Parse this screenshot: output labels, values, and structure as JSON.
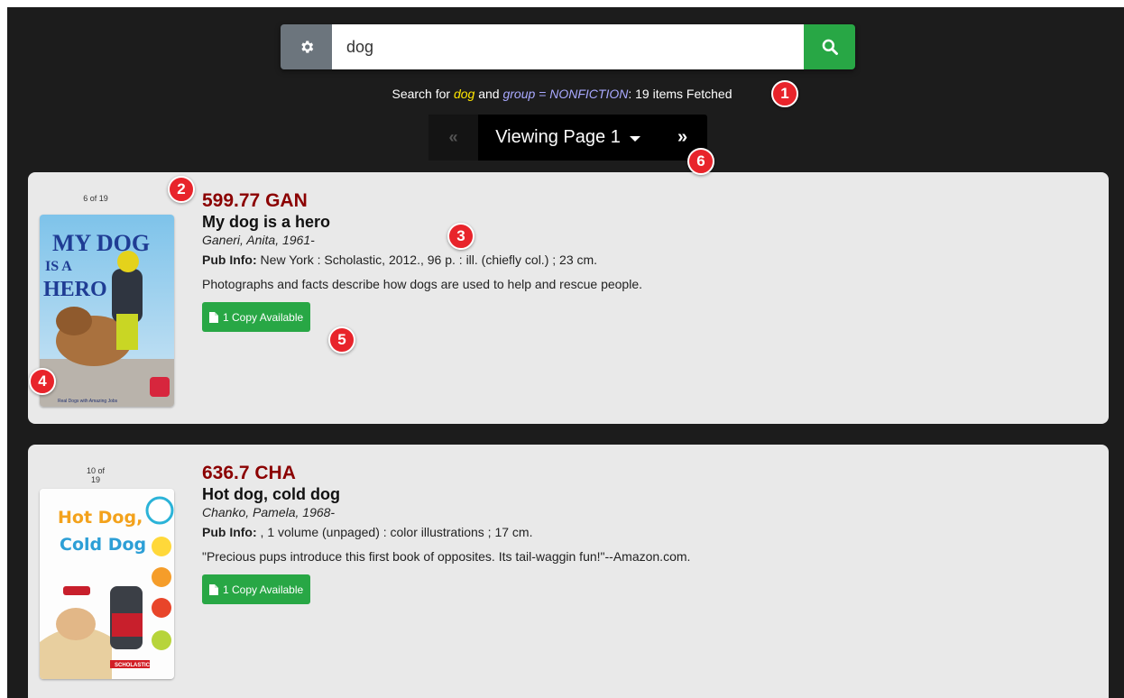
{
  "search": {
    "query": "dog",
    "status_prefix": "Search for",
    "status_keyword": "dog",
    "status_and": "and",
    "status_group": "group = NONFICTION",
    "status_suffix": ": 19 items Fetched"
  },
  "pager": {
    "prev_icon": "double-chevron-left-icon",
    "page_label": "Viewing Page 1",
    "next_icon": "double-chevron-right-icon"
  },
  "results": [
    {
      "position": "6 of 19",
      "call_number": "599.77 GAN",
      "title": "My dog is a hero",
      "author": "Ganeri, Anita, 1961-",
      "pub_label": "Pub Info:",
      "pub_info": "New York : Scholastic, 2012., 96 p. : ill. (chiefly col.) ; 23 cm.",
      "summary": "Photographs and facts describe how dogs are used to help and rescue people.",
      "availability": "1 Copy Available",
      "cover_text": [
        "MY DOG",
        "IS A",
        "HERO"
      ],
      "cover_caption": "Real Dogs with Amazing Jobs"
    },
    {
      "position": "10 of 19",
      "call_number": "636.7 CHA",
      "title": "Hot dog, cold dog",
      "author": "Chanko, Pamela, 1968-",
      "pub_label": "Pub Info:",
      "pub_info": ", 1 volume (unpaged) : color illustrations ; 17 cm.",
      "summary": "\"Precious pups introduce this first book of opposites. Its tail-waggin fun!\"--Amazon.com.",
      "availability": "1 Copy Available",
      "cover_text": [
        "Hot Dog,",
        "Cold Dog"
      ],
      "cover_caption": "SCHOLASTIC"
    }
  ],
  "markers": [
    "1",
    "2",
    "3",
    "4",
    "5",
    "6"
  ],
  "colors": {
    "background": "#1c1c1c",
    "search_button": "#28a745",
    "gear_button": "#6c757d",
    "call_number": "#8b0000",
    "marker": "#e8242b"
  }
}
